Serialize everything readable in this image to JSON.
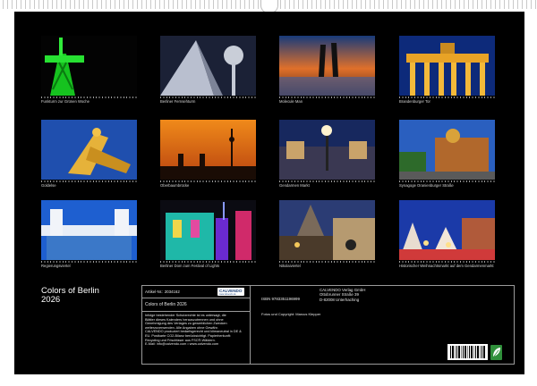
{
  "calendar": {
    "title_line1": "Colors of Berlin",
    "title_line2": "2026"
  },
  "months": [
    {
      "caption": "Funkturm zur Grünen Woche"
    },
    {
      "caption": "Berliner Fernsehturm"
    },
    {
      "caption": "Molecule Man"
    },
    {
      "caption": "Brandenburger Tor"
    },
    {
      "caption": "Goldelse"
    },
    {
      "caption": "Oberbaumbrücke"
    },
    {
      "caption": "Gendarmen Markt"
    },
    {
      "caption": "Synagoge Oranienburger Straße"
    },
    {
      "caption": "Regierungsviertel"
    },
    {
      "caption": "Berliner Dom zum Festival of Lights"
    },
    {
      "caption": "Nikolaiviertel"
    },
    {
      "caption": "Historischer Weihnachtsmarkt auf dem Gendarmenmarkt"
    }
  ],
  "info": {
    "article_label": "Artikel-Nr.: 2034162",
    "logo_text": "CALVENDO",
    "logo_sub": "www.calvendo.de",
    "product_title": "Colors of Berlin 2026",
    "isbn": "ISBN 9783351196999",
    "publisher_line1": "CALVENDO Verlag GmbH",
    "publisher_line2": "Ottobrunner Straße 39",
    "publisher_line3": "D-82008 Unterhaching",
    "copyright": "Fotos und Copyright: Marcus Klepper",
    "legal_lines": [
      "Infolge bestehender Schutzrechte ist es untersagt, die",
      "Blätter dieses Kalenders herauszutrennen und ohne",
      "Genehmigung des Verlages zu gewerblichen Zwecken",
      "weiterzuverwenden. Alle Angaben ohne Gewähr.",
      "CALVENDO produziert bedarfsgerecht und klimaneutral in DE &",
      "EU. Postkarte CO2-Bilanz berücksichtigt. Papierherkunft:",
      "Recycling und Frischfaser aus FSC®-Wäldern.",
      "E-Mail: info@calvendo.com • www.calvendo.com"
    ]
  },
  "colors": {
    "sheet_background": "#000000",
    "text": "#ffffff"
  }
}
